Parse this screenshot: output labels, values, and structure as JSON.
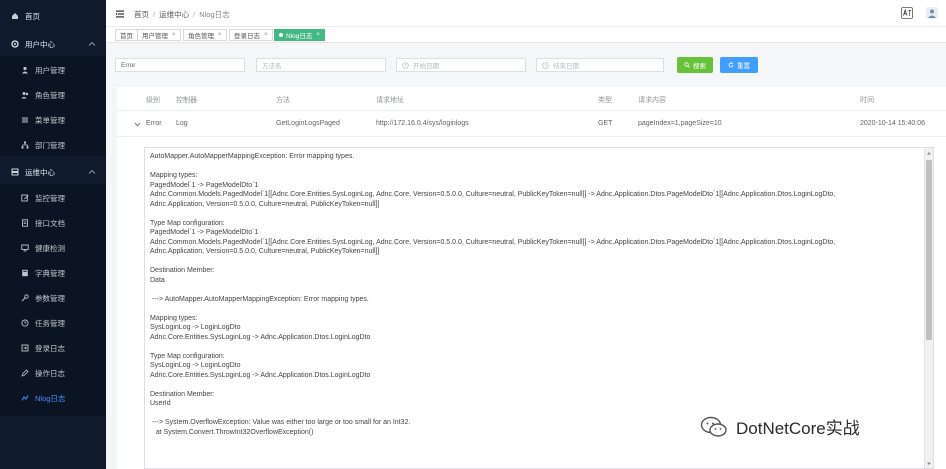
{
  "sidebar": {
    "home": "首页",
    "user_center": "用户中心",
    "user_items": [
      "用户管理",
      "角色管理",
      "菜单管理",
      "部门管理"
    ],
    "ops_center": "运维中心",
    "ops_items": [
      "监控管理",
      "接口文档",
      "健康检测",
      "字典管理",
      "参数管理",
      "任务管理",
      "登录日志",
      "操作日志",
      "Nlog日志"
    ],
    "active_item": "Nlog日志",
    "active_color": "#4c8dff"
  },
  "header": {
    "breadcrumb": [
      "首页",
      "运维中心",
      "Nlog日志"
    ]
  },
  "tags": {
    "items": [
      "首页",
      "用户管理",
      "角色管理",
      "登录日志",
      "Nlog日志"
    ],
    "active_color": "#42b983"
  },
  "filters": {
    "level_value": "Error",
    "method_placeholder": "方法名",
    "start_placeholder": "开始日期",
    "end_placeholder": "结束日期",
    "search_label": "搜索",
    "reset_label": "重置"
  },
  "table": {
    "headers": [
      "级别",
      "控制器",
      "方法",
      "请求地址",
      "类型",
      "请求内容",
      "时间"
    ],
    "row": [
      "Error",
      "Log",
      "GetLoginLogsPaged",
      "http://172.16.0.4/sys/loginlogs",
      "GET",
      "pageIndex=1,pageSize=10",
      "2020-10-14 15:40:06"
    ]
  },
  "detail": {
    "lines": [
      "AutoMapper.AutoMapperMappingException: Error mapping types.",
      "",
      "Mapping types:",
      "PagedModel`1 -> PageModelDto`1",
      "Adnc.Common.Models.PagedModel`1[[Adnc.Core.Entities.SysLoginLog, Adnc.Core, Version=0.5.0.0, Culture=neutral, PublicKeyToken=null]] -> Adnc.Application.Dtos.PageModelDto`1[[Adnc.Application.Dtos.LoginLogDto,",
      "Adnc.Application, Version=0.5.0.0, Culture=neutral, PublicKeyToken=null]]",
      "",
      "Type Map configuration:",
      "PagedModel`1 -> PageModelDto`1",
      "Adnc.Common.Models.PagedModel`1[[Adnc.Core.Entities.SysLoginLog, Adnc.Core, Version=0.5.0.0, Culture=neutral, PublicKeyToken=null]] -> Adnc.Application.Dtos.PageModelDto`1[[Adnc.Application.Dtos.LoginLogDto,",
      "Adnc.Application, Version=0.5.0.0, Culture=neutral, PublicKeyToken=null]]",
      "",
      "Destination Member:",
      "Data",
      "",
      " ---> AutoMapper.AutoMapperMappingException: Error mapping types.",
      "",
      "Mapping types:",
      "SysLoginLog -> LoginLogDto",
      "Adnc.Core.Entities.SysLoginLog -> Adnc.Application.Dtos.LoginLogDto",
      "",
      "Type Map configuration:",
      "SysLoginLog -> LoginLogDto",
      "Adnc.Core.Entities.SysLoginLog -> Adnc.Application.Dtos.LoginLogDto",
      "",
      "Destination Member:",
      "UserId",
      "",
      " ---> System.OverflowException: Value was either too large or too small for an Int32.",
      "   at System.Convert.ThrowInt32OverflowException()"
    ]
  },
  "watermark": {
    "text": "DotNetCore实战"
  }
}
